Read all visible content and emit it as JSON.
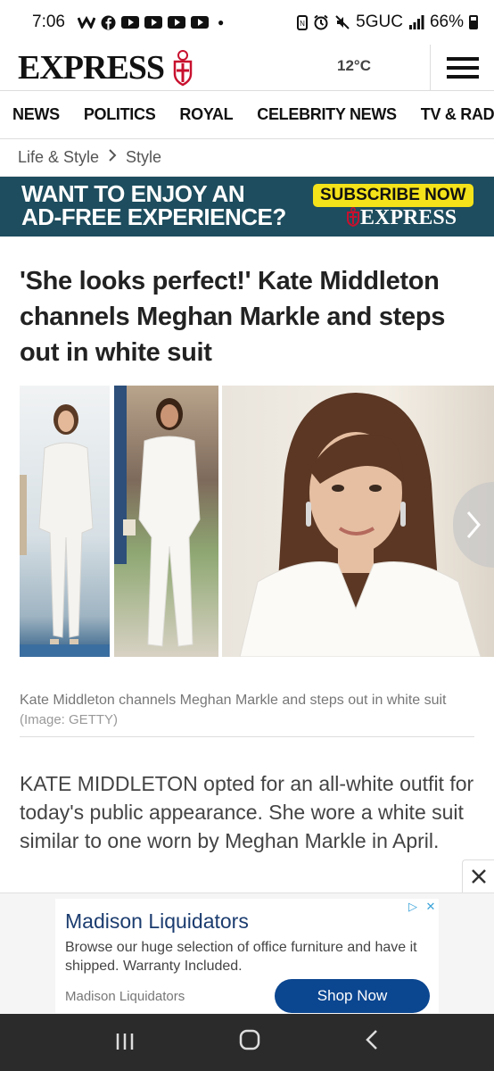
{
  "status_bar": {
    "time": "7:06",
    "network": "5GUC",
    "battery": "66%",
    "notification_icons": [
      "wiggle-icon",
      "facebook-icon",
      "youtube-icon",
      "youtube-icon",
      "youtube-icon",
      "youtube-icon",
      "dot-icon"
    ],
    "system_icons": [
      "nfc-icon",
      "alarm-icon",
      "mute-icon",
      "signal-icon",
      "battery-icon"
    ]
  },
  "header": {
    "logo": "EXPRESS",
    "temperature": "12°C",
    "menu_icon": "hamburger-icon"
  },
  "nav": {
    "items": [
      "NEWS",
      "POLITICS",
      "ROYAL",
      "CELEBRITY NEWS",
      "TV & RADIO"
    ]
  },
  "breadcrumb": {
    "items": [
      "Life & Style",
      "Style"
    ],
    "separator_icon": "chevron-right-icon"
  },
  "banner": {
    "line1": "WANT TO ENJOY AN",
    "line2": "AD-FREE EXPERIENCE?",
    "cta": "SUBSCRIBE NOW",
    "logo": "EXPRESS",
    "colors": {
      "background": "#1d4d5e",
      "cta_bg": "#f4e21a"
    }
  },
  "article": {
    "headline": "'She looks perfect!' Kate Middleton channels Meghan Markle and steps out in white suit",
    "caption": "Kate Middleton channels Meghan Markle and steps out in white suit",
    "credit": "(Image: GETTY)",
    "intro": "KATE MIDDLETON opted for an all-white outfit for today's public appearance. She wore a white suit similar to one worn by Meghan Markle in April."
  },
  "ad": {
    "title": "Madison Liquidators",
    "description": "Browse our huge selection of office furniture and have it shipped. Warranty Included.",
    "advertiser": "Madison Liquidators",
    "cta": "Shop Now",
    "colors": {
      "cta_bg": "#0b4690",
      "title": "#1b3c6f"
    }
  },
  "system_nav": {
    "icons": [
      "recent-apps-icon",
      "home-icon",
      "back-icon"
    ]
  }
}
